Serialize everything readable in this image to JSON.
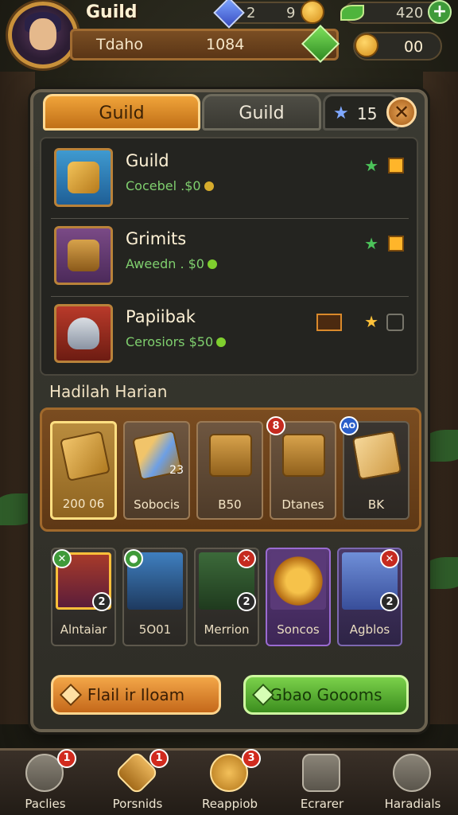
{
  "header": {
    "player_name": "Guild",
    "gems_value": "2",
    "gems_value_2": "9",
    "leaf_value": "420",
    "profile_name": "Tdaho",
    "profile_number": "1084",
    "gold_value": "00"
  },
  "tabs": [
    {
      "label": "Guild",
      "active": true
    },
    {
      "label": "Guild",
      "active": false
    },
    {
      "label": "15",
      "icon": "star-icon",
      "active": false
    }
  ],
  "guild_list": [
    {
      "title": "Guild",
      "subtitle": "Cocebel  .$0",
      "icon": "hammer-shield-icon",
      "status_icon": "green-star-icon"
    },
    {
      "title": "Grimits",
      "subtitle": "Aweedn  . $0",
      "icon": "treasure-chest-icon",
      "status_icon": "green-star-icon"
    },
    {
      "title": "Papiibak",
      "subtitle": "Cerosiors  $50",
      "icon": "robot-head-icon",
      "status_icon": "gold-star-icon"
    }
  ],
  "daily_rewards": {
    "title": "Hadilah Harian",
    "items": [
      {
        "label": "200 06",
        "badge": "",
        "extra": ""
      },
      {
        "label": "Sobocis",
        "badge": "",
        "extra": "23"
      },
      {
        "label": "B50",
        "badge": "",
        "extra": ""
      },
      {
        "label": "Dtanes",
        "badge": "8",
        "extra": ""
      },
      {
        "label": "BK",
        "badge": "AO",
        "extra": ""
      }
    ]
  },
  "heroes": [
    {
      "label": "Alntaiar",
      "badge": "2"
    },
    {
      "label": "5O01",
      "badge": ""
    },
    {
      "label": "Merrion",
      "badge": "2"
    },
    {
      "label": "Soncos",
      "badge": ""
    },
    {
      "label": "Agblos",
      "badge": "2"
    }
  ],
  "actions": {
    "left_button": "Flail ir Iloam",
    "right_button": "Gbao Goooms"
  },
  "bottom_nav": [
    {
      "label": "Paclies",
      "badge": "1",
      "icon": "refresh-icon"
    },
    {
      "label": "Porsnids",
      "badge": "1",
      "icon": "sword-diamond-icon"
    },
    {
      "label": "Reappiob",
      "badge": "3",
      "icon": "gold-coin-icon"
    },
    {
      "label": "Ecrarer",
      "badge": "",
      "icon": "backpack-icon"
    },
    {
      "label": "Haradials",
      "badge": "",
      "icon": "settings-icon"
    }
  ],
  "colors": {
    "accent_orange": "#f0a43a",
    "accent_green": "#4cc35a",
    "panel_bg": "#2e2d26"
  }
}
